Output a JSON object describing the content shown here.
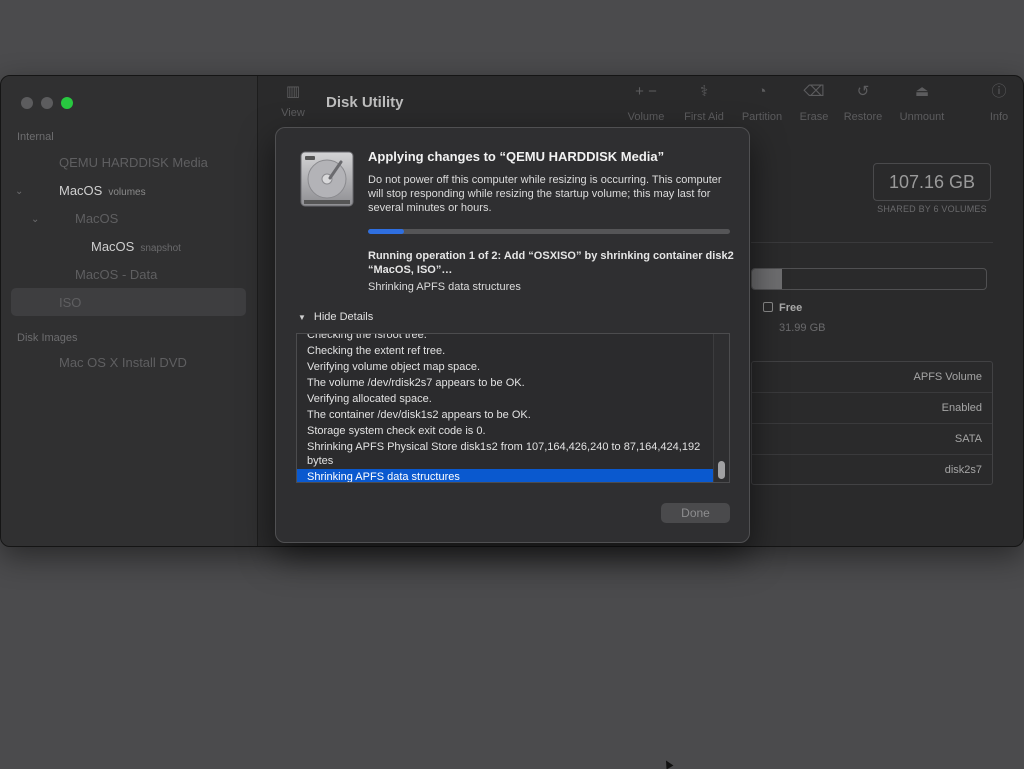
{
  "sidebar": {
    "section_internal": "Internal",
    "items": [
      {
        "label": "QEMU HARDDISK Media",
        "sub": ""
      },
      {
        "label": "MacOS",
        "sub": "volumes"
      },
      {
        "label": "MacOS",
        "sub": ""
      },
      {
        "label": "MacOS",
        "sub": "snapshot"
      },
      {
        "label": "MacOS - Data",
        "sub": ""
      },
      {
        "label": "ISO",
        "sub": ""
      }
    ],
    "section_images": "Disk Images",
    "image_items": [
      {
        "label": "Mac OS X Install DVD"
      }
    ]
  },
  "toolbar": {
    "view_label": "View",
    "title": "Disk Utility",
    "buttons": [
      {
        "label": "Volume",
        "icon": "plus-minus-icon"
      },
      {
        "label": "First Aid",
        "icon": "stethoscope-icon"
      },
      {
        "label": "Partition",
        "icon": "pie-icon"
      },
      {
        "label": "Erase",
        "icon": "erase-icon"
      },
      {
        "label": "Restore",
        "icon": "restore-icon"
      },
      {
        "label": "Unmount",
        "icon": "eject-icon"
      },
      {
        "label": "Info",
        "icon": "info-icon"
      }
    ]
  },
  "main": {
    "capacity": "107.16 GB",
    "capacity_note": "SHARED BY 6 VOLUMES",
    "usage_fraction": 0.13,
    "free_label": "Free",
    "free_value": "31.99 GB",
    "info_values": [
      "APFS Volume",
      "Enabled",
      "SATA",
      "disk2s7"
    ]
  },
  "dialog": {
    "title": "Applying changes to “QEMU HARDDISK Media”",
    "message": "Do not power off this computer while resizing is occurring. This computer will stop responding while resizing the startup volume; this may last for several minutes or hours.",
    "progress_fraction": 0.1,
    "operation": "Running operation 1 of 2: Add “OSXISO” by shrinking container disk2 “MacOS, ISO”…",
    "operation_status": "Shrinking APFS data structures",
    "details_toggle": "Hide Details",
    "log_lines": [
      "Checking the fsroot tree.",
      "Checking the extent ref tree.",
      "Verifying volume object map space.",
      "The volume /dev/rdisk2s7 appears to be OK.",
      "Verifying allocated space.",
      "The container /dev/disk1s2 appears to be OK.",
      "Storage system check exit code is 0.",
      "Shrinking APFS Physical Store disk1s2 from 107,164,426,240 to 87,164,424,192 bytes",
      "Shrinking APFS data structures"
    ],
    "done_label": "Done"
  }
}
